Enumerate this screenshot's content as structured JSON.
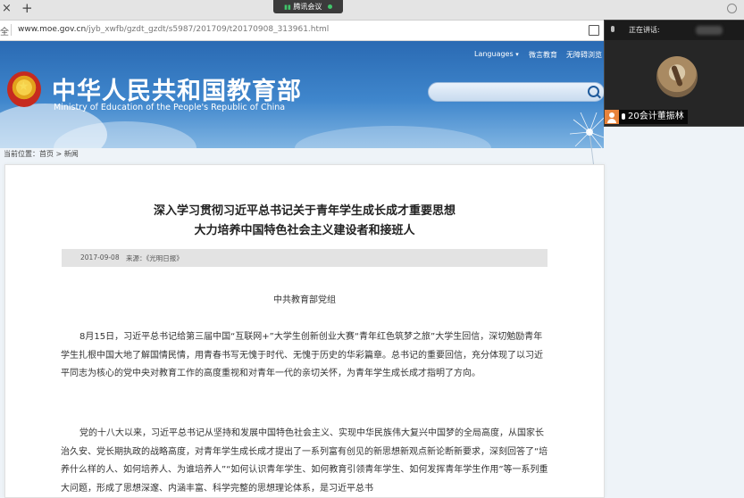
{
  "browser": {
    "tab_close_glyph": "×",
    "new_tab_glyph": "+",
    "meeting_pill_label": "腾讯会议",
    "address_left_glyph": "全",
    "url_domain": "www.moe.gov.cn",
    "url_path": "/jyb_xwfb/gzdt_gzdt/s5987/201709/t20170908_313961.html"
  },
  "header": {
    "title": "中华人民共和国教育部",
    "subtitle": "Ministry of Education of the People's Republic of China",
    "languages_label": "Languages",
    "link_1": "微言教育",
    "link_2": "无障碍浏览"
  },
  "breadcrumb": "当前位置：首页 > 新闻",
  "article": {
    "title_line1": "深入学习贯彻习近平总书记关于青年学生成长成才重要思想",
    "title_line2": "大力培养中国特色社会主义建设者和接班人",
    "date": "2017-09-08",
    "source": "来源：《光明日报》",
    "author": "中共教育部党组",
    "paragraph_1": "8月15日，习近平总书记给第三届中国“互联网+”大学生创新创业大赛“青年红色筑梦之旅”大学生回信，深切勉励青年学生扎根中国大地了解国情民情，用青春书写无愧于时代、无愧于历史的华彩篇章。总书记的重要回信，充分体现了以习近平同志为核心的党中央对教育工作的高度重视和对青年一代的亲切关怀，为青年学生成长成才指明了方向。",
    "paragraph_2": "党的十八大以来，习近平总书记从坚持和发展中国特色社会主义、实现中华民族伟大复兴中国梦的全局高度，从国家长治久安、党长期执政的战略高度，对青年学生成长成才提出了一系列富有创见的新思想新观点新论断新要求，深刻回答了“培养什么样的人、如何培养人、为谁培养人”“如何认识青年学生、如何教育引领青年学生、如何发挥青年学生作用”等一系列重大问题，形成了思想深邃、内涵丰富、科学完整的思想理论体系，是习近平总书"
  },
  "meeting_panel": {
    "speaking_label": "正在讲话:",
    "participant_name": "20会计董振林"
  },
  "colors": {
    "header_blue": "#2a6ab3",
    "meeting_green": "#41c66b",
    "user_icon_orange": "#e8833a"
  }
}
